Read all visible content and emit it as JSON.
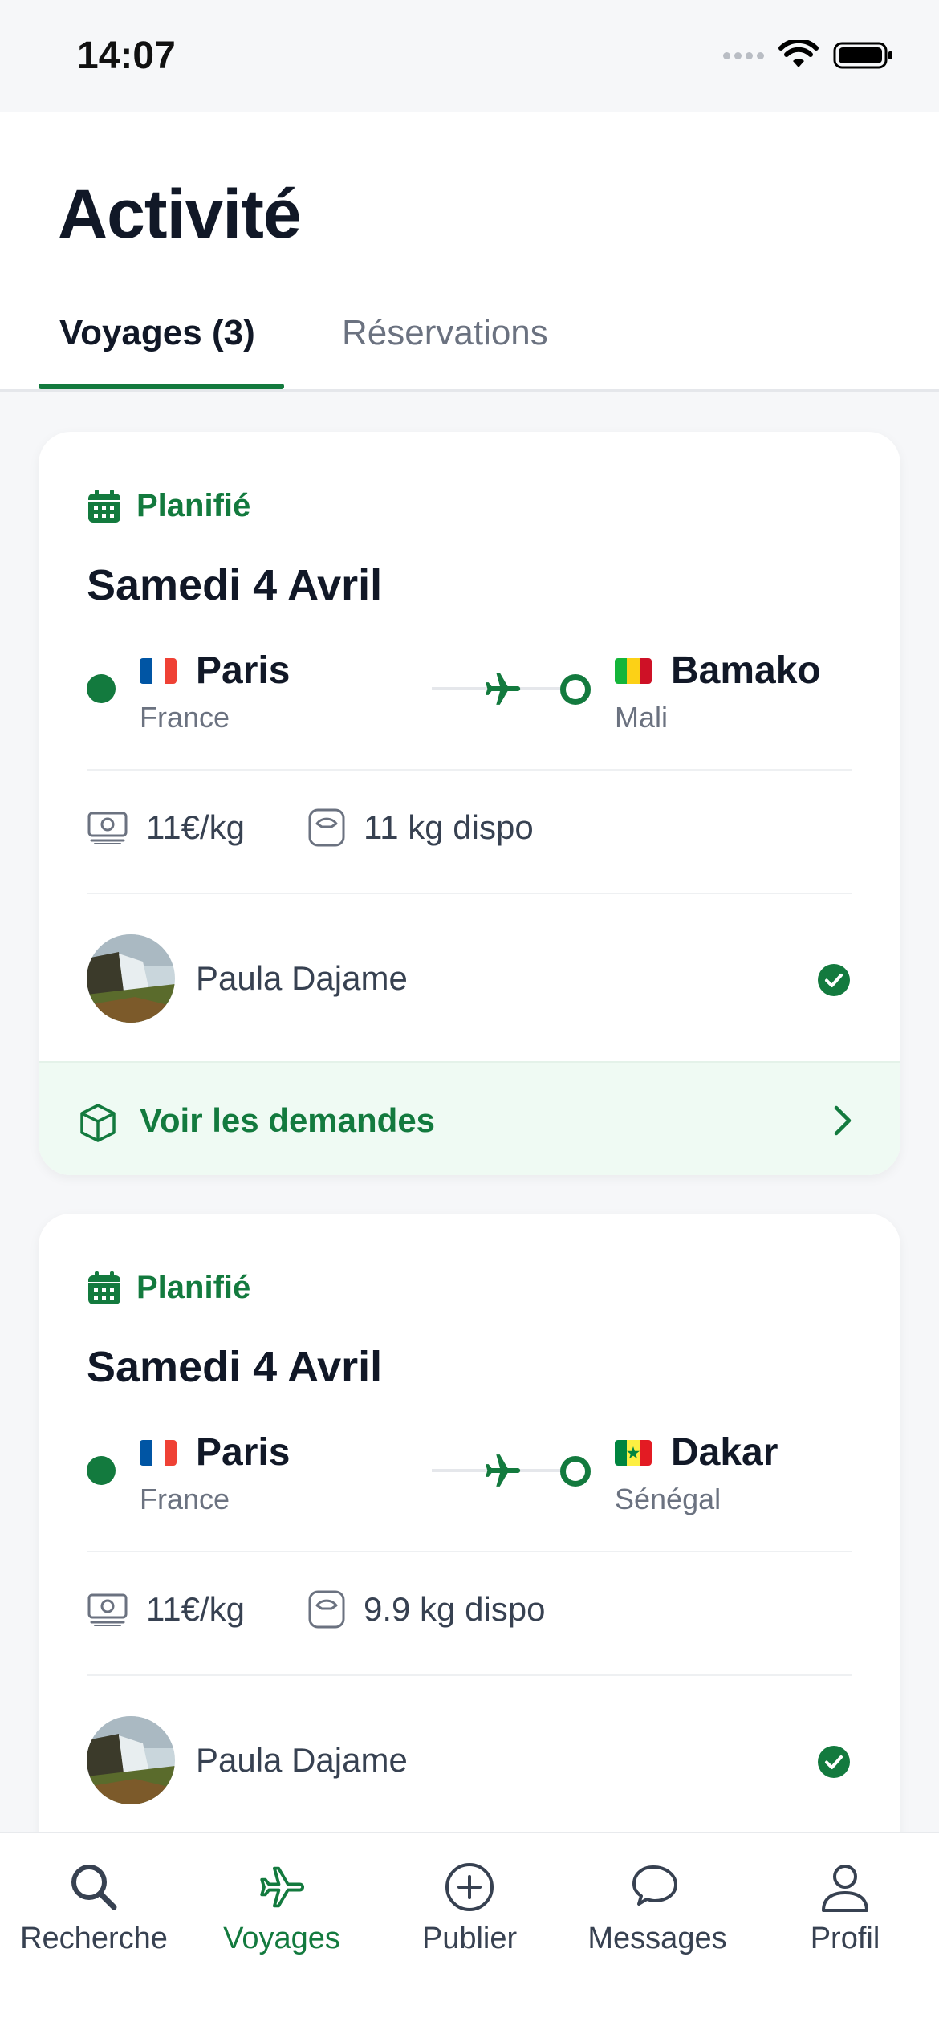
{
  "status_bar": {
    "time": "14:07"
  },
  "header": {
    "title": "Activité",
    "tabs": [
      {
        "label": "Voyages (3)",
        "active": true
      },
      {
        "label": "Réservations",
        "active": false
      }
    ]
  },
  "trips": [
    {
      "status": "Planifié",
      "date": "Samedi 4 Avril",
      "origin": {
        "city": "Paris",
        "country": "France",
        "flag": "france-flag-icon"
      },
      "destination": {
        "city": "Bamako",
        "country": "Mali",
        "flag": "mali-flag-icon"
      },
      "price": "11€/kg",
      "capacity": "11 kg dispo",
      "traveler": "Paula Dajame",
      "verified": true,
      "requests_label": "Voir les demandes"
    },
    {
      "status": "Planifié",
      "date": "Samedi 4 Avril",
      "origin": {
        "city": "Paris",
        "country": "France",
        "flag": "france-flag-icon"
      },
      "destination": {
        "city": "Dakar",
        "country": "Sénégal",
        "flag": "senegal-flag-icon"
      },
      "price": "11€/kg",
      "capacity": "9.9 kg dispo",
      "traveler": "Paula Dajame",
      "verified": true
    }
  ],
  "tab_bar": {
    "items": [
      {
        "label": "Recherche",
        "icon": "search-icon",
        "active": false
      },
      {
        "label": "Voyages",
        "icon": "plane-icon",
        "active": true
      },
      {
        "label": "Publier",
        "icon": "plus-circle-icon",
        "active": false
      },
      {
        "label": "Messages",
        "icon": "chat-bubbles-icon",
        "active": false
      },
      {
        "label": "Profil",
        "icon": "person-icon",
        "active": false
      }
    ]
  },
  "colors": {
    "accent": "#137a3e",
    "accent_light": "#effaf3",
    "text": "#111827",
    "muted": "#6b7280"
  }
}
